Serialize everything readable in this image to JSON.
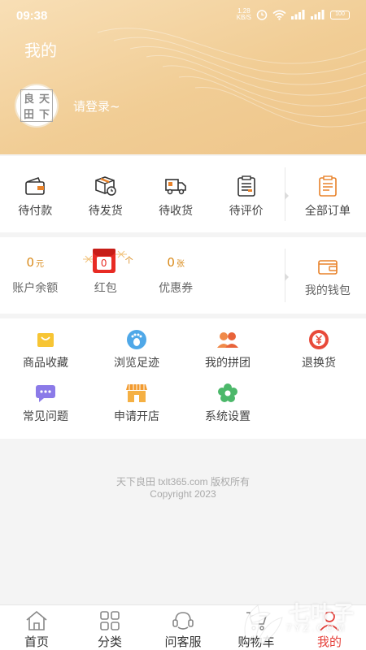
{
  "status_bar": {
    "time": "09:38",
    "net_speed_value": "1.28",
    "net_speed_unit": "KB/S",
    "battery": "100"
  },
  "header": {
    "title": "我的",
    "login_prompt": "请登录~",
    "avatar_logo_chars": [
      "良",
      "天",
      "田",
      "下"
    ]
  },
  "orders": {
    "items": [
      {
        "label": "待付款",
        "icon": "wallet-icon"
      },
      {
        "label": "待发货",
        "icon": "box-clock-icon"
      },
      {
        "label": "待收货",
        "icon": "truck-icon"
      },
      {
        "label": "待评价",
        "icon": "clipboard-icon"
      }
    ],
    "all": {
      "label": "全部订单",
      "icon": "orders-list-icon"
    }
  },
  "wallet": {
    "balance": {
      "value": "0",
      "unit": "元",
      "label": "账户余额"
    },
    "red_packet": {
      "value": "0",
      "unit": "个",
      "label": "红包"
    },
    "coupons": {
      "value": "0",
      "unit": "张",
      "label": "优惠券"
    },
    "my_wallet": {
      "label": "我的钱包",
      "icon": "wallet-card-icon"
    }
  },
  "tools": {
    "items": [
      {
        "label": "商品收藏",
        "icon": "favorites-bag-icon"
      },
      {
        "label": "浏览足迹",
        "icon": "footprint-icon"
      },
      {
        "label": "我的拼团",
        "icon": "group-buy-icon"
      },
      {
        "label": "退换货",
        "icon": "refund-icon"
      },
      {
        "label": "常见问题",
        "icon": "faq-chat-icon"
      },
      {
        "label": "申请开店",
        "icon": "shop-icon"
      },
      {
        "label": "系统设置",
        "icon": "settings-flower-icon"
      }
    ]
  },
  "footer": {
    "line1": "天下良田 txlt365.com 版权所有",
    "line2": "Copyright 2023"
  },
  "tabbar": {
    "items": [
      {
        "label": "首页",
        "icon": "home-icon"
      },
      {
        "label": "分类",
        "icon": "category-grid-icon"
      },
      {
        "label": "问客服",
        "icon": "customer-service-icon"
      },
      {
        "label": "购物车",
        "icon": "cart-icon"
      },
      {
        "label": "我的",
        "icon": "user-icon",
        "active": true
      }
    ]
  },
  "watermark": {
    "text": "七叶子",
    "sub": "7YZ.COM"
  },
  "colors": {
    "header_gradient": [
      "#f8dfb6",
      "#eec58a"
    ],
    "accent_orange": "#e8822a",
    "price": "#d98a1a",
    "active_tab": "#e5403a",
    "red_packet": "#e82b24"
  }
}
